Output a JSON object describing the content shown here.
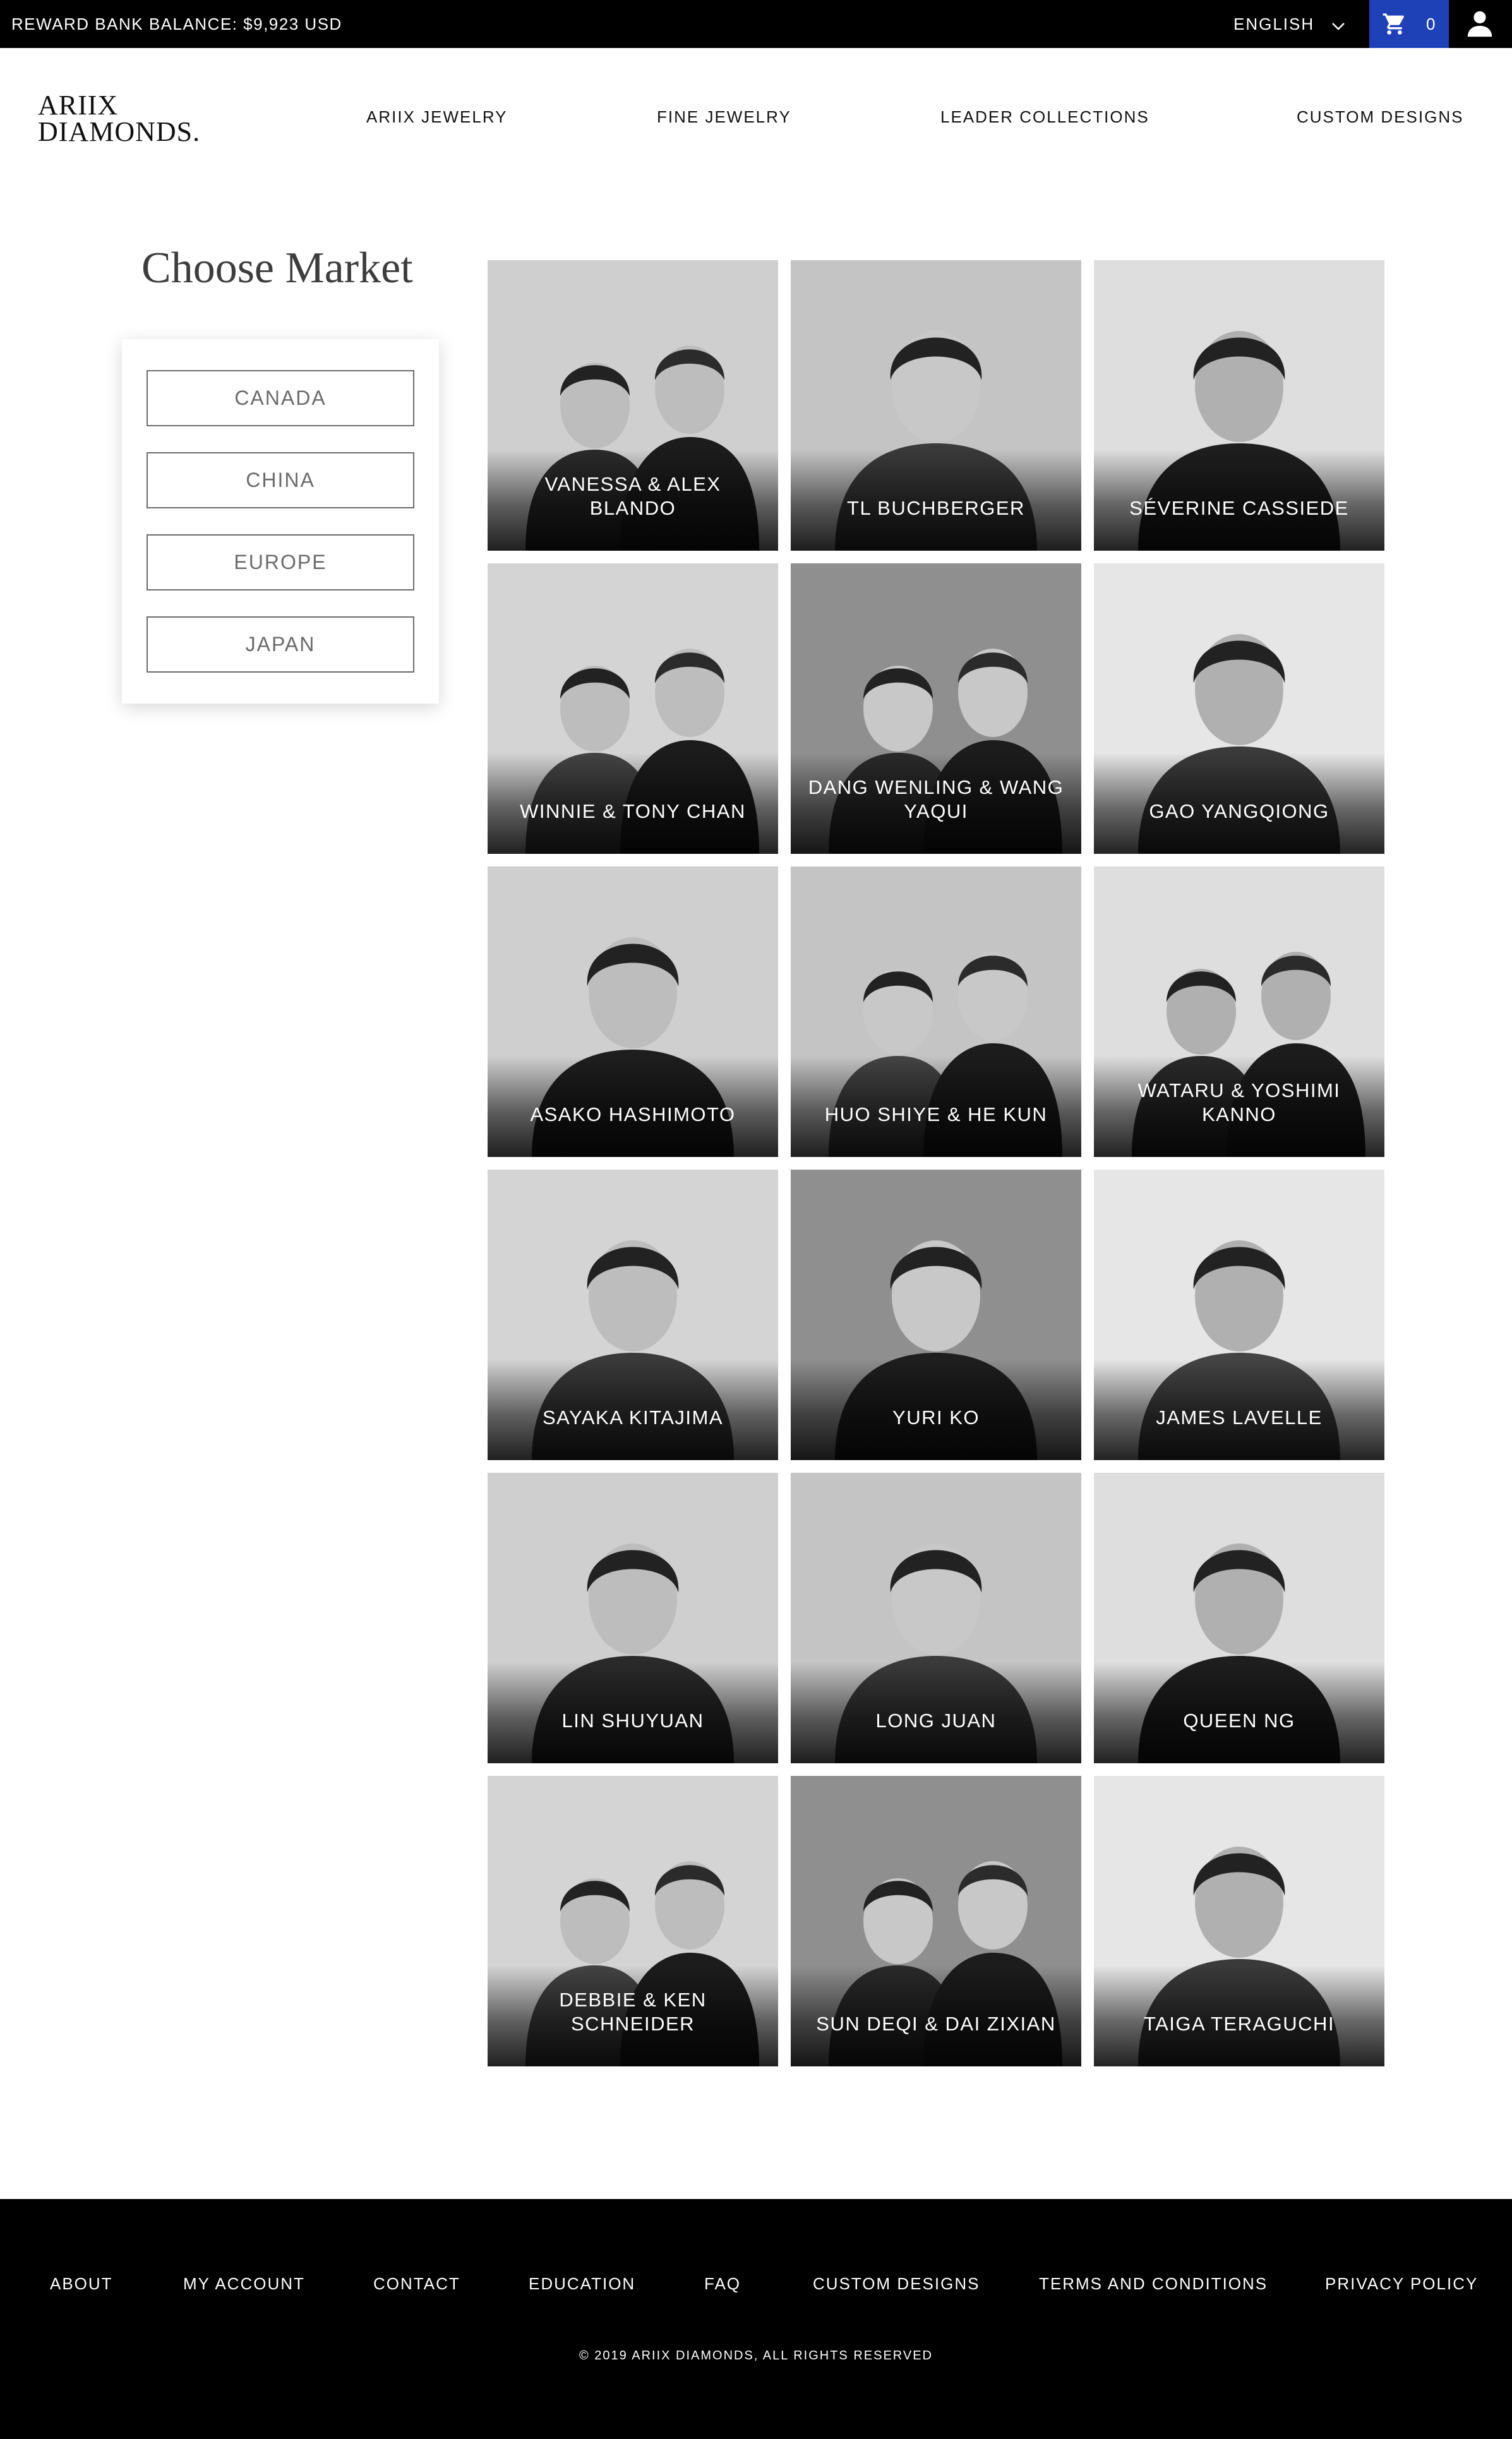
{
  "topbar": {
    "balance": "REWARD BANK BALANCE:  $9,923 USD",
    "language": "ENGLISH",
    "cart_count": "0"
  },
  "logo": {
    "line1": "ARIIX",
    "line2": "DIAMONDS."
  },
  "nav": [
    "ARIIX JEWELRY",
    "FINE JEWELRY",
    "LEADER COLLECTIONS",
    "CUSTOM DESIGNS"
  ],
  "market": {
    "title": "Choose Market",
    "options": [
      "CANADA",
      "CHINA",
      "EUROPE",
      "JAPAN"
    ]
  },
  "leaders": [
    "VANESSA & ALEX BLANDO",
    "TL BUCHBERGER",
    "SÉVERINE CASSIEDE",
    "WINNIE & TONY CHAN",
    "DANG WENLING & WANG YAQUI",
    "GAO YANGQIONG",
    "ASAKO HASHIMOTO",
    "HUO SHIYE & HE KUN",
    "WATARU & YOSHIMI KANNO",
    "SAYAKA KITAJIMA",
    "YURI KO",
    "JAMES LAVELLE",
    "LIN SHUYUAN",
    "LONG JUAN",
    "QUEEN NG",
    "DEBBIE & KEN SCHNEIDER",
    "SUN DEQI & DAI ZIXIAN",
    "TAIGA TERAGUCHI"
  ],
  "footer": {
    "links": [
      "ABOUT",
      "MY ACCOUNT",
      "CONTACT",
      "EDUCATION",
      "FAQ",
      "CUSTOM DESIGNS",
      "TERMS AND CONDITIONS",
      "PRIVACY POLICY"
    ],
    "copyright": "© 2019 ARIIX DIAMONDS,   ALL RIGHTS RESERVED"
  },
  "colors": {
    "cart_accent": "#1f41b8",
    "bar": "#000000",
    "market_text": "#6b6b6b"
  },
  "icons": {
    "cart": "cart-icon",
    "user": "user-icon",
    "language_chevron": "chevron-down-icon"
  }
}
